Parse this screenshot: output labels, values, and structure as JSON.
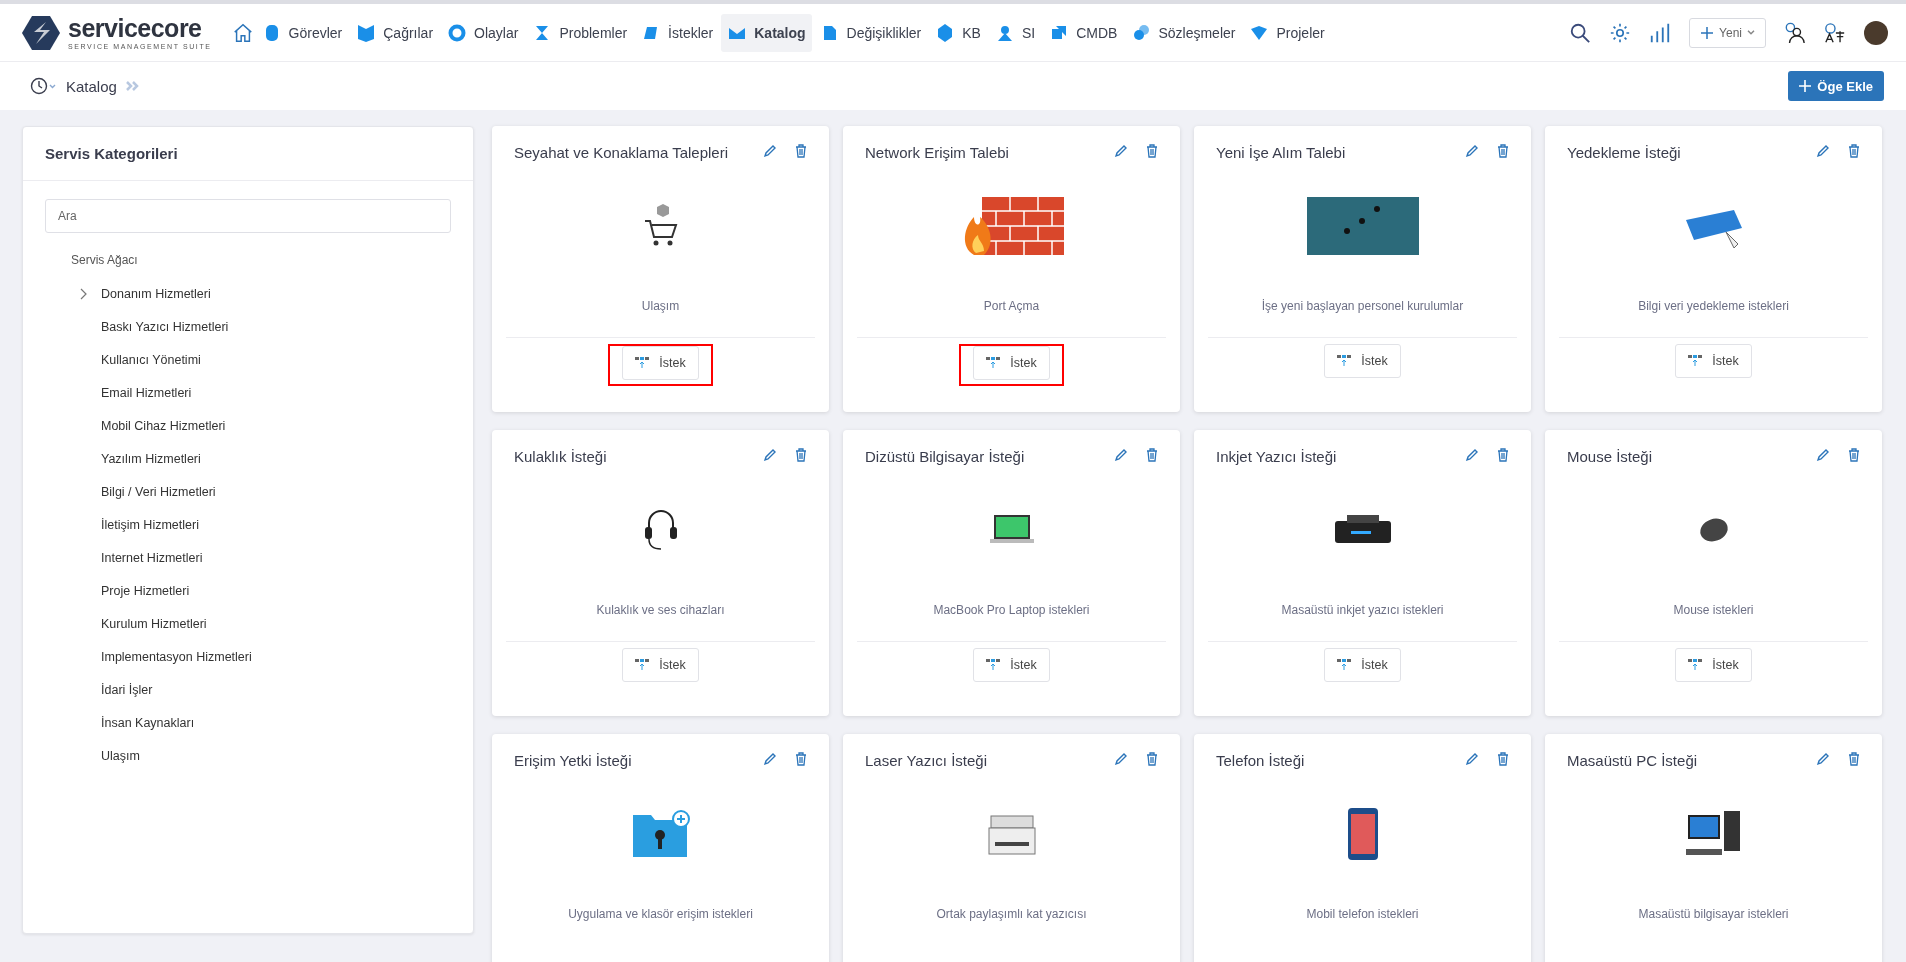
{
  "brand": {
    "name": "service",
    "name_accent": "core",
    "tagline": "SERVICE MANAGEMENT SUITE"
  },
  "nav": [
    {
      "label": "Görevler",
      "selected": false
    },
    {
      "label": "Çağrılar",
      "selected": false
    },
    {
      "label": "Olaylar",
      "selected": false
    },
    {
      "label": "Problemler",
      "selected": false
    },
    {
      "label": "İstekler",
      "selected": false
    },
    {
      "label": "Katalog",
      "selected": true
    },
    {
      "label": "Değişiklikler",
      "selected": false
    },
    {
      "label": "KB",
      "selected": false
    },
    {
      "label": "SI",
      "selected": false
    },
    {
      "label": "CMDB",
      "selected": false
    },
    {
      "label": "Sözleşmeler",
      "selected": false
    },
    {
      "label": "Projeler",
      "selected": false
    }
  ],
  "new_button": "Yeni",
  "breadcrumb": "Katalog",
  "add_button": "Öge Ekle",
  "sidebar": {
    "title": "Servis Kategorileri",
    "search": {
      "placeholder": "Ara"
    },
    "tree_title": "Servis Ağacı",
    "items": [
      {
        "label": "Donanım Hizmetleri",
        "expandable": true
      },
      {
        "label": "Baskı Yazıcı Hizmetleri",
        "expandable": false
      },
      {
        "label": "Kullanıcı Yönetimi",
        "expandable": false
      },
      {
        "label": "Email Hizmetleri",
        "expandable": false
      },
      {
        "label": "Mobil Cihaz Hizmetleri",
        "expandable": false
      },
      {
        "label": "Yazılım Hizmetleri",
        "expandable": false
      },
      {
        "label": "Bilgi / Veri Hizmetleri",
        "expandable": false
      },
      {
        "label": "İletişim Hizmetleri",
        "expandable": false
      },
      {
        "label": "Internet Hizmetleri",
        "expandable": false
      },
      {
        "label": "Proje Hizmetleri",
        "expandable": false
      },
      {
        "label": "Kurulum Hizmetleri",
        "expandable": false
      },
      {
        "label": "Implementasyon Hizmetleri",
        "expandable": false
      },
      {
        "label": "İdari İşler",
        "expandable": false
      },
      {
        "label": "İnsan Kaynakları",
        "expandable": false
      },
      {
        "label": "Ulaşım",
        "expandable": false
      }
    ]
  },
  "cards": [
    {
      "title": "Seyahat ve Konaklama Talepleri",
      "kind": "cart",
      "description": "Ulaşım",
      "button": "İstek",
      "highlighted": true
    },
    {
      "title": "Network Erişim Talebi",
      "kind": "firewall",
      "description": "Port Açma",
      "button": "İstek",
      "highlighted": true
    },
    {
      "title": "Yeni İşe Alım Talebi",
      "kind": "banner",
      "description": "İşe yeni başlayan personel kurulumlar",
      "button": "İstek",
      "highlighted": false
    },
    {
      "title": "Yedekleme İsteği",
      "kind": "backup",
      "description": "Bilgi veri yedekleme istekleri",
      "button": "İstek",
      "highlighted": false
    },
    {
      "title": "Kulaklık İsteği",
      "kind": "headset",
      "description": "Kulaklık ve ses cihazları",
      "button": "İstek",
      "highlighted": false
    },
    {
      "title": "Dizüstü Bilgisayar İsteği",
      "kind": "laptop",
      "description": "MacBook Pro Laptop istekleri",
      "button": "İstek",
      "highlighted": false
    },
    {
      "title": "Inkjet Yazıcı İsteği",
      "kind": "inkjet",
      "description": "Masaüstü inkjet yazıcı istekleri",
      "button": "İstek",
      "highlighted": false
    },
    {
      "title": "Mouse İsteği",
      "kind": "mouse",
      "description": "Mouse istekleri",
      "button": "İstek",
      "highlighted": false
    },
    {
      "title": "Erişim Yetki İsteği",
      "kind": "folder",
      "description": "Uygulama ve klasör erişim istekleri"
    },
    {
      "title": "Laser Yazıcı İsteği",
      "kind": "laser",
      "description": "Ortak paylaşımlı kat yazıcısı"
    },
    {
      "title": "Telefon İsteği",
      "kind": "phone",
      "description": "Mobil telefon istekleri"
    },
    {
      "title": "Masaüstü PC İsteği",
      "kind": "desktop",
      "description": "Masaüstü bilgisayar istekleri"
    }
  ]
}
